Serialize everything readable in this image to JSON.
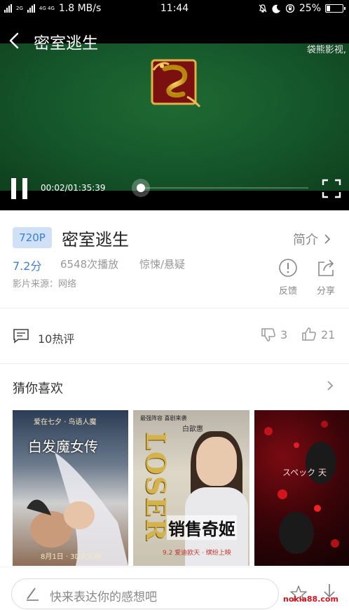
{
  "status_bar": {
    "network_top": "2G",
    "network_type": "4G 4G",
    "speed": "1.8 MB/s",
    "time": "11:44",
    "battery_percent": "25%",
    "battery_level": 0.25
  },
  "player": {
    "title": "密室逃生",
    "watermark": "袋熊影视,",
    "time": "00:02/01:35:39",
    "progress": 0.0003
  },
  "info": {
    "quality": "720P",
    "title": "密室逃生",
    "intro_label": "简介",
    "rating": "7.2分",
    "plays": "6548次播放",
    "genre": "惊悚/悬疑",
    "source": "影片来源：网络",
    "feedback_label": "反馈",
    "share_label": "分享"
  },
  "comments": {
    "label": "10热评",
    "dislikes": "3",
    "likes": "21"
  },
  "recommendations": {
    "title": "猜你喜欢",
    "posters": [
      {
        "top_text": "爱在七夕 · 鸟语人魔",
        "title": "白发魔女传",
        "date": "8月1日 · 3D大公映"
      },
      {
        "top_text": "最强阵容 喜剧来袭",
        "actor": "白歆惠",
        "brand": "LOSER",
        "title": "销售奇姬",
        "date": "9.2 爱迪欧天 · 缤纷上映"
      },
      {
        "title": "スペック 天"
      }
    ]
  },
  "bottom_bar": {
    "input_placeholder": "快来表达你的感想吧",
    "site": "nokia88.com"
  },
  "colors": {
    "accent_blue": "#3c7fd6",
    "badge_bg": "#cfe0f7",
    "video_green": "#1f6a33"
  }
}
